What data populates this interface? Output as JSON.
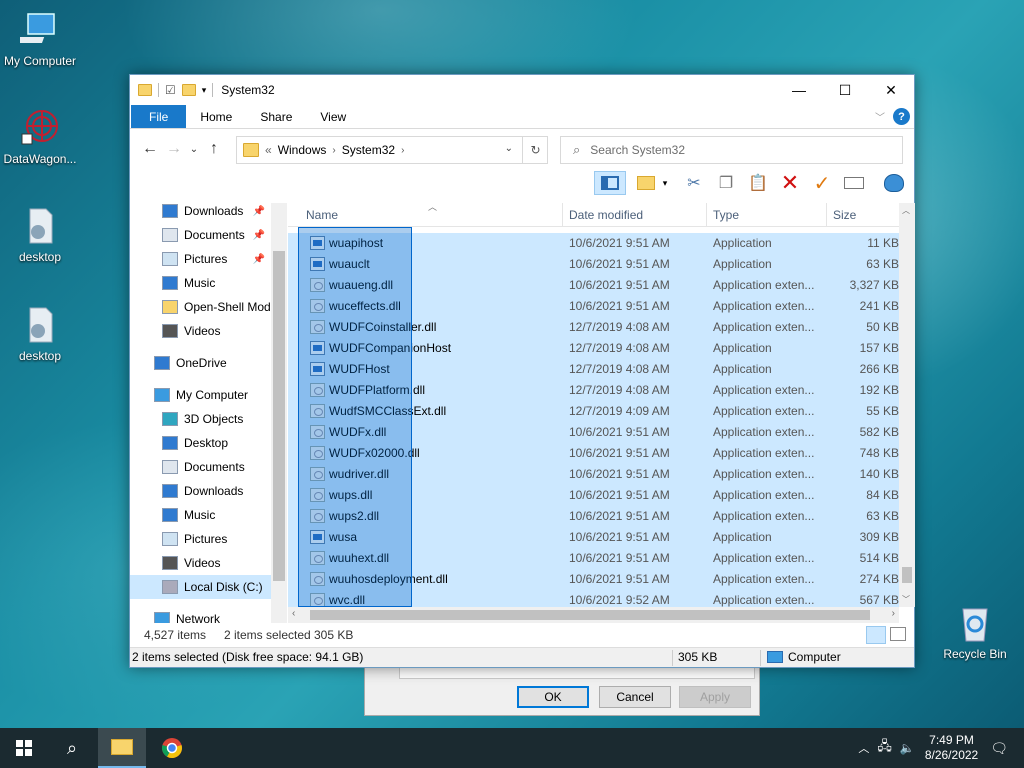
{
  "desktop": {
    "icons": [
      {
        "label": "My Computer"
      },
      {
        "label": "DataWagon..."
      },
      {
        "label": "desktop"
      },
      {
        "label": "desktop"
      },
      {
        "label": "Recycle Bin"
      }
    ]
  },
  "window": {
    "title": "System32",
    "ribbon_tabs": [
      "File",
      "Home",
      "Share",
      "View"
    ],
    "address": {
      "prefix": "«",
      "segments": [
        "Windows",
        "System32"
      ]
    },
    "search_placeholder": "Search System32"
  },
  "nav": {
    "items": [
      {
        "label": "Downloads",
        "icon": "download-icon",
        "pinned": true
      },
      {
        "label": "Documents",
        "icon": "document-icon",
        "pinned": true
      },
      {
        "label": "Pictures",
        "icon": "pictures-icon",
        "pinned": true
      },
      {
        "label": "Music",
        "icon": "music-icon",
        "pinned": false
      },
      {
        "label": "Open-Shell Mod",
        "icon": "folder-icon",
        "pinned": false
      },
      {
        "label": "Videos",
        "icon": "videos-icon",
        "pinned": false
      },
      {
        "label": "OneDrive",
        "icon": "cloud-icon",
        "pinned": false
      },
      {
        "label": "My Computer",
        "icon": "computer-icon",
        "pinned": false
      },
      {
        "label": "3D Objects",
        "icon": "cube-icon",
        "pinned": false
      },
      {
        "label": "Desktop",
        "icon": "desktop-icon",
        "pinned": false
      },
      {
        "label": "Documents",
        "icon": "document-icon",
        "pinned": false
      },
      {
        "label": "Downloads",
        "icon": "download-icon",
        "pinned": false
      },
      {
        "label": "Music",
        "icon": "music-icon",
        "pinned": false
      },
      {
        "label": "Pictures",
        "icon": "pictures-icon",
        "pinned": false
      },
      {
        "label": "Videos",
        "icon": "videos-icon",
        "pinned": false
      },
      {
        "label": "Local Disk (C:)",
        "icon": "drive-icon",
        "pinned": false
      },
      {
        "label": "Network",
        "icon": "network-icon",
        "pinned": false
      }
    ]
  },
  "columns": {
    "name": "Name",
    "date": "Date modified",
    "type": "Type",
    "size": "Size"
  },
  "files": [
    {
      "name": "wuapihost",
      "date": "10/6/2021 9:51 AM",
      "type": "Application",
      "size": "11 KB",
      "kind": "app"
    },
    {
      "name": "wuauclt",
      "date": "10/6/2021 9:51 AM",
      "type": "Application",
      "size": "63 KB",
      "kind": "app"
    },
    {
      "name": "wuaueng.dll",
      "date": "10/6/2021 9:51 AM",
      "type": "Application exten...",
      "size": "3,327 KB",
      "kind": "dll"
    },
    {
      "name": "wuceffects.dll",
      "date": "10/6/2021 9:51 AM",
      "type": "Application exten...",
      "size": "241 KB",
      "kind": "dll"
    },
    {
      "name": "WUDFCoinstaller.dll",
      "date": "12/7/2019 4:08 AM",
      "type": "Application exten...",
      "size": "50 KB",
      "kind": "dll"
    },
    {
      "name": "WUDFCompanionHost",
      "date": "12/7/2019 4:08 AM",
      "type": "Application",
      "size": "157 KB",
      "kind": "app"
    },
    {
      "name": "WUDFHost",
      "date": "12/7/2019 4:08 AM",
      "type": "Application",
      "size": "266 KB",
      "kind": "app"
    },
    {
      "name": "WUDFPlatform.dll",
      "date": "12/7/2019 4:08 AM",
      "type": "Application exten...",
      "size": "192 KB",
      "kind": "dll"
    },
    {
      "name": "WudfSMCClassExt.dll",
      "date": "12/7/2019 4:09 AM",
      "type": "Application exten...",
      "size": "55 KB",
      "kind": "dll"
    },
    {
      "name": "WUDFx.dll",
      "date": "10/6/2021 9:51 AM",
      "type": "Application exten...",
      "size": "582 KB",
      "kind": "dll"
    },
    {
      "name": "WUDFx02000.dll",
      "date": "10/6/2021 9:51 AM",
      "type": "Application exten...",
      "size": "748 KB",
      "kind": "dll"
    },
    {
      "name": "wudriver.dll",
      "date": "10/6/2021 9:51 AM",
      "type": "Application exten...",
      "size": "140 KB",
      "kind": "dll"
    },
    {
      "name": "wups.dll",
      "date": "10/6/2021 9:51 AM",
      "type": "Application exten...",
      "size": "84 KB",
      "kind": "dll"
    },
    {
      "name": "wups2.dll",
      "date": "10/6/2021 9:51 AM",
      "type": "Application exten...",
      "size": "63 KB",
      "kind": "dll"
    },
    {
      "name": "wusa",
      "date": "10/6/2021 9:51 AM",
      "type": "Application",
      "size": "309 KB",
      "kind": "app"
    },
    {
      "name": "wuuhext.dll",
      "date": "10/6/2021 9:51 AM",
      "type": "Application exten...",
      "size": "514 KB",
      "kind": "dll"
    },
    {
      "name": "wuuhosdeployment.dll",
      "date": "10/6/2021 9:51 AM",
      "type": "Application exten...",
      "size": "274 KB",
      "kind": "dll"
    },
    {
      "name": "wvc.dll",
      "date": "10/6/2021 9:52 AM",
      "type": "Application exten...",
      "size": "567 KB",
      "kind": "dll"
    }
  ],
  "status": {
    "item_count": "4,527 items",
    "selected": "2 items selected",
    "selected_size": "305 KB",
    "bar_left": "2 items selected (Disk free space: 94.1 GB)",
    "bar_size": "305 KB",
    "bar_location": "Computer"
  },
  "dialog": {
    "ok": "OK",
    "cancel": "Cancel",
    "apply": "Apply"
  },
  "taskbar": {
    "time": "7:49 PM",
    "date": "8/26/2022"
  },
  "colors": {
    "selection": "#cce8ff",
    "accent": "#1979ca"
  }
}
